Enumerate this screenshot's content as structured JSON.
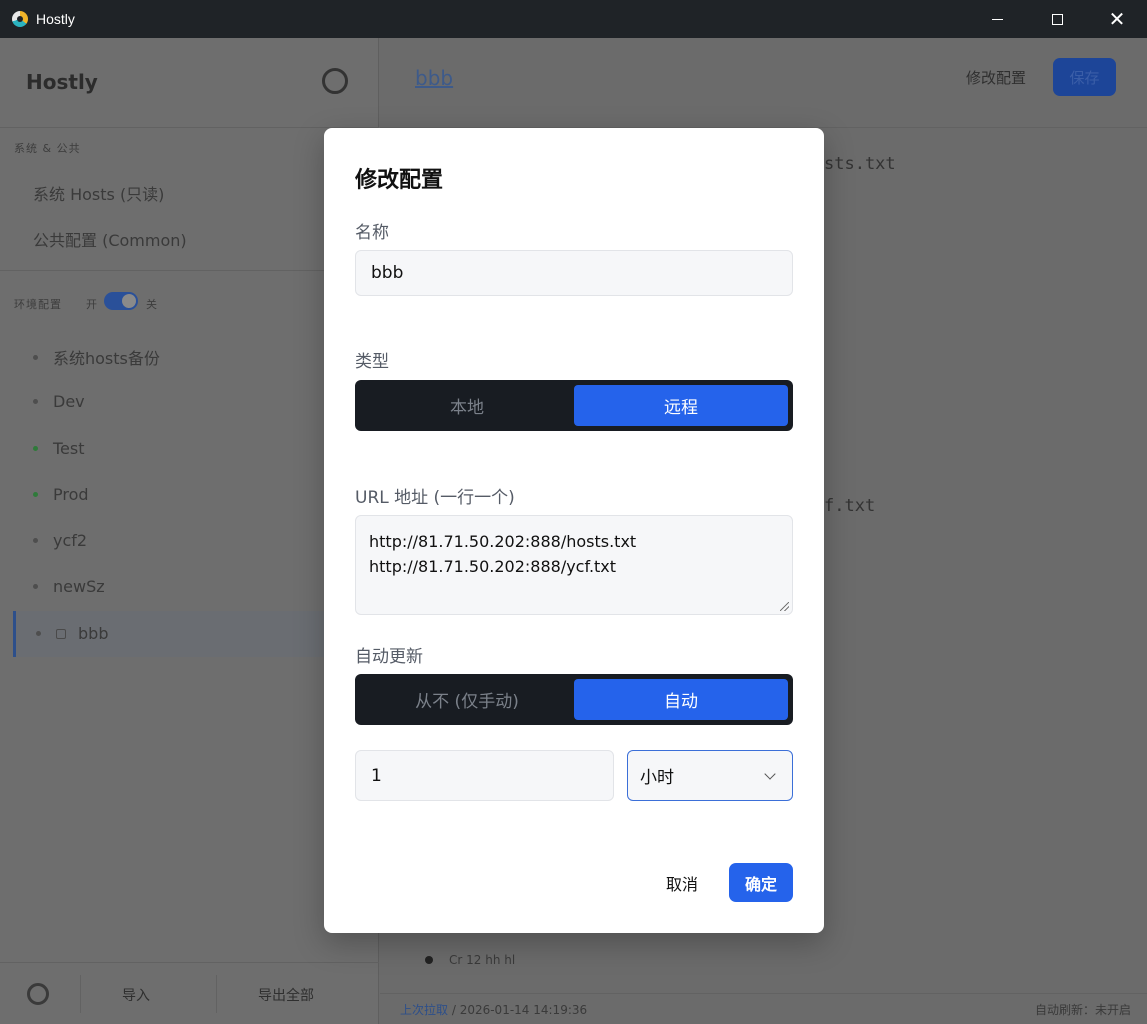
{
  "window": {
    "title": "Hostly",
    "icon": "app-logo-icon"
  },
  "sidebar": {
    "brand": "Hostly",
    "section_system": "系统 & 公共",
    "system_items": [
      "系统 Hosts (只读)",
      "公共配置 (Common)"
    ],
    "section_env": "环境配置",
    "toggle_left": "开",
    "toggle_right": "关",
    "profiles": [
      {
        "label": "系统hosts备份",
        "status": "off"
      },
      {
        "label": "Dev",
        "status": "off"
      },
      {
        "label": "Test",
        "status": "on"
      },
      {
        "label": "Prod",
        "status": "on"
      },
      {
        "label": "ycf2",
        "status": "off"
      },
      {
        "label": "newSz",
        "status": "off"
      },
      {
        "label": "bbb",
        "status": "off",
        "active": true
      }
    ],
    "footer": {
      "import": "导入",
      "export": "导出全部"
    }
  },
  "main": {
    "title": "bbb",
    "edit_button": "修改配置",
    "save_button": "保存",
    "fragment_1": "sts.txt",
    "fragment_2": "f.txt",
    "log_entry": "Cr 12 hh hl",
    "status": {
      "link": "上次拉取",
      "time": "2026-01-14 14:19:36",
      "right": "自动刷新：未开启"
    }
  },
  "modal": {
    "title": "修改配置",
    "name_label": "名称",
    "name_value": "bbb",
    "type_label": "类型",
    "type_options": [
      "本地",
      "远程"
    ],
    "type_selected": "远程",
    "url_label": "URL 地址 (一行一个)",
    "url_lines": [
      "http://81.71.50.202:888/hosts.txt",
      "http://81.71.50.202:888/ycf.txt"
    ],
    "auto_label": "自动更新",
    "auto_options": [
      "从不 (仅手动)",
      "自动"
    ],
    "auto_selected": "自动",
    "interval_value": "1",
    "interval_unit": "小时",
    "cancel": "取消",
    "confirm": "确定",
    "accent": "#2563eb"
  }
}
